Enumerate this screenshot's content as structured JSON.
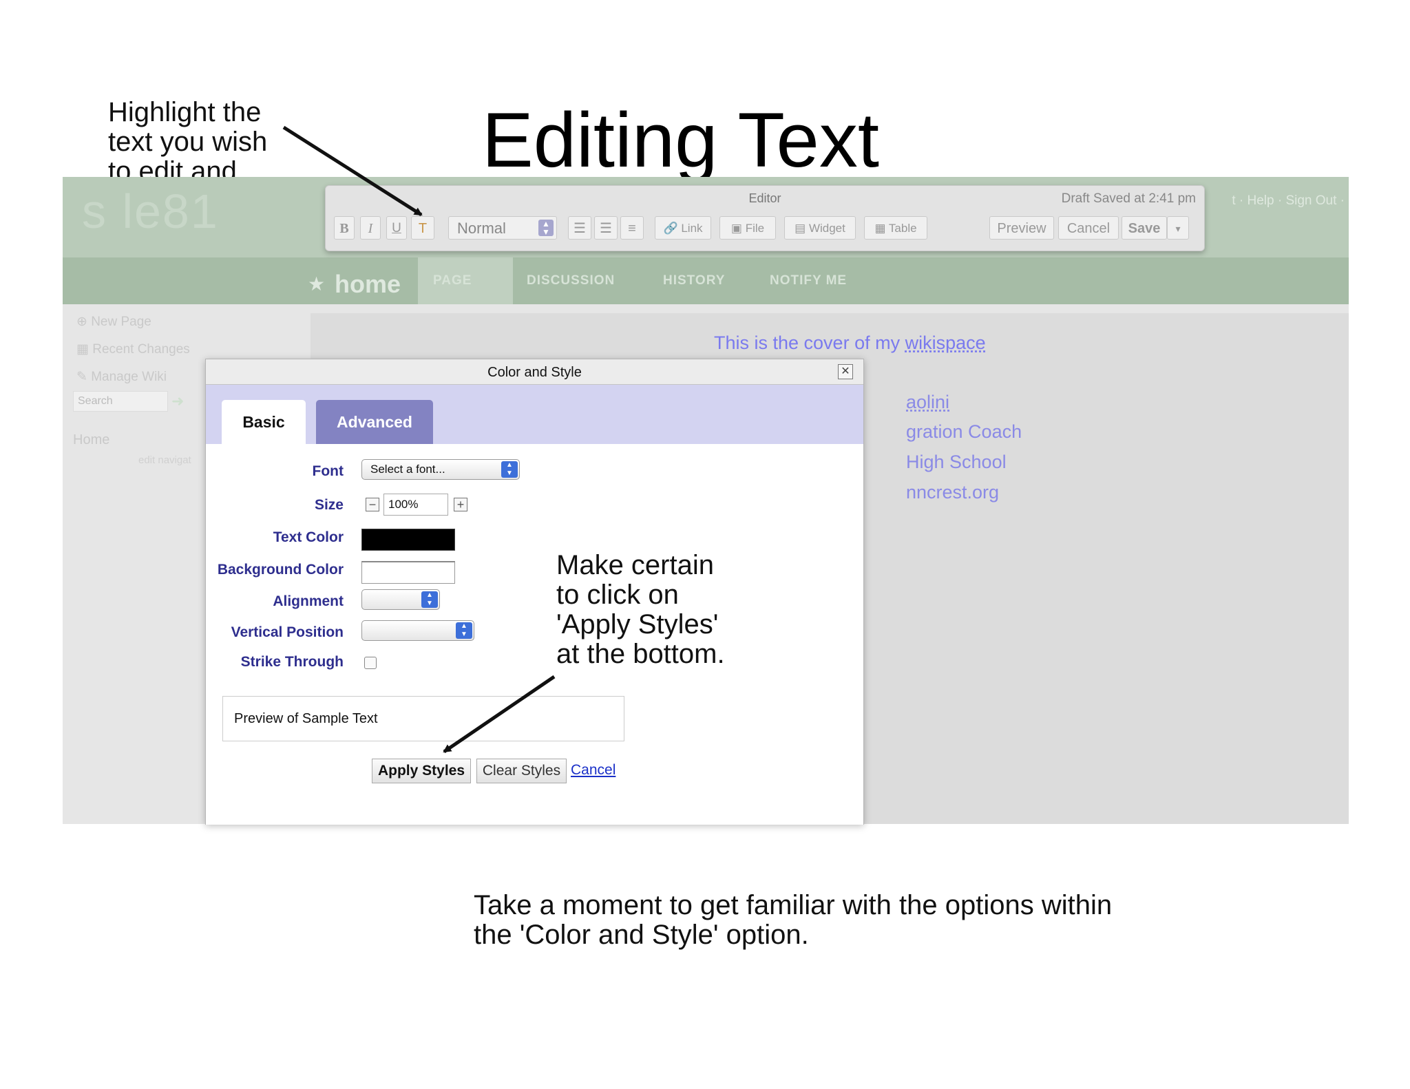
{
  "slide": {
    "title": "Editing Text",
    "caption_left": "Highlight the\ntext you wish\nto edit and\nthen click on\nthe \"T\" with\npainters\npallet",
    "caption_mid": "Make certain\nto click on\n'Apply Styles'\nat the bottom.",
    "caption_bottom": "Take a moment to get familiar with the options within\nthe 'Color and Style' option."
  },
  "wiki": {
    "logo_text": "s    le81",
    "top_links": "t · Help · Sign Out ·",
    "nav_home": "home",
    "tabs": [
      "PAGE",
      "DISCUSSION",
      "HISTORY",
      "NOTIFY ME"
    ],
    "sidebar": {
      "items": [
        "New Page",
        "Recent Changes",
        "Manage Wiki"
      ],
      "search_placeholder": "Search",
      "home": "Home",
      "edit_navigation": "edit navigat"
    },
    "content": {
      "heading_prefix": "This is the cover of my ",
      "heading_link": "wikispace",
      "lines": [
        "aolini",
        "gration Coach",
        "High School",
        "nncrest.org"
      ]
    }
  },
  "editor": {
    "title": "Editor",
    "draft_status": "Draft Saved at 2:41 pm",
    "format_buttons": [
      "B",
      "I",
      "U"
    ],
    "paragraph_style": "Normal",
    "link_label": "Link",
    "file_label": "File",
    "widget_label": "Widget",
    "table_label": "Table",
    "preview_label": "Preview",
    "cancel_label": "Cancel",
    "save_label": "Save"
  },
  "dialog": {
    "title": "Color and Style",
    "tabs": {
      "basic": "Basic",
      "advanced": "Advanced"
    },
    "labels": {
      "font": "Font",
      "size": "Size",
      "text_color": "Text Color",
      "background_color": "Background Color",
      "alignment": "Alignment",
      "vertical_position": "Vertical Position",
      "strike_through": "Strike Through"
    },
    "font_select": "Select a font...",
    "size_value": "100%",
    "text_color": "#000000",
    "background_color": "#ffffff",
    "alignment_value": "",
    "vertical_position_value": "",
    "strike_through_checked": false,
    "preview_text": "Preview of Sample Text",
    "apply_label": "Apply Styles",
    "clear_label": "Clear Styles",
    "cancel_label": "Cancel"
  },
  "colors": {
    "accent_purple": "#8383c2",
    "label_blue": "#2e2e8e",
    "link_blue": "#1a30c8",
    "wiki_green": "#b9cbb9"
  }
}
